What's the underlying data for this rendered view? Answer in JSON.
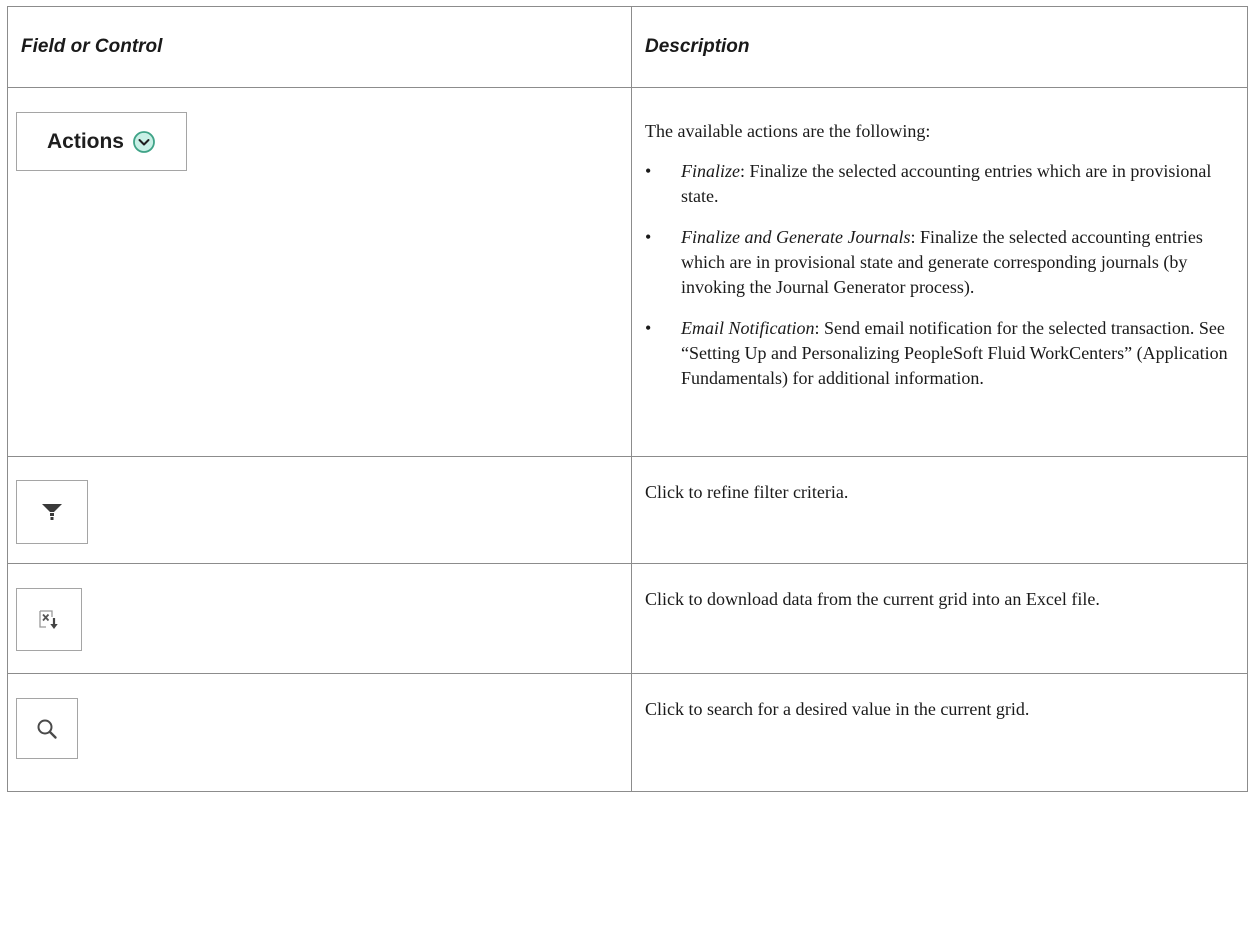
{
  "table": {
    "headers": {
      "field": "Field or Control",
      "description": "Description"
    },
    "rows": {
      "actions": {
        "button_label": "Actions",
        "icon": "chevron-down-circle-icon",
        "intro": "The available actions are the following:",
        "bullets": [
          {
            "term": "Finalize",
            "text": ": Finalize the selected accounting entries which are in provisional state."
          },
          {
            "term": "Finalize and Generate Journals",
            "text": ": Finalize the selected accounting entries which are in provisional state and generate corresponding journals (by invoking the Journal Generator process)."
          },
          {
            "term": "Email Notification",
            "text": ": Send email notification for the selected transaction. See “Setting Up and Personalizing PeopleSoft Fluid WorkCenters” (Application Fundamentals) for additional information."
          }
        ]
      },
      "filter": {
        "icon": "filter-icon",
        "text": "Click to refine filter criteria."
      },
      "download": {
        "icon": "excel-download-icon",
        "text": "Click to download data from the current grid into an Excel file."
      },
      "search": {
        "icon": "search-icon",
        "text": "Click to search for a desired value in the current grid."
      }
    },
    "colors": {
      "border": "#8c8c8c",
      "icon_accent": "#3fa387",
      "icon_fill": "#c8f0e6"
    },
    "bullet_glyph": "•"
  }
}
